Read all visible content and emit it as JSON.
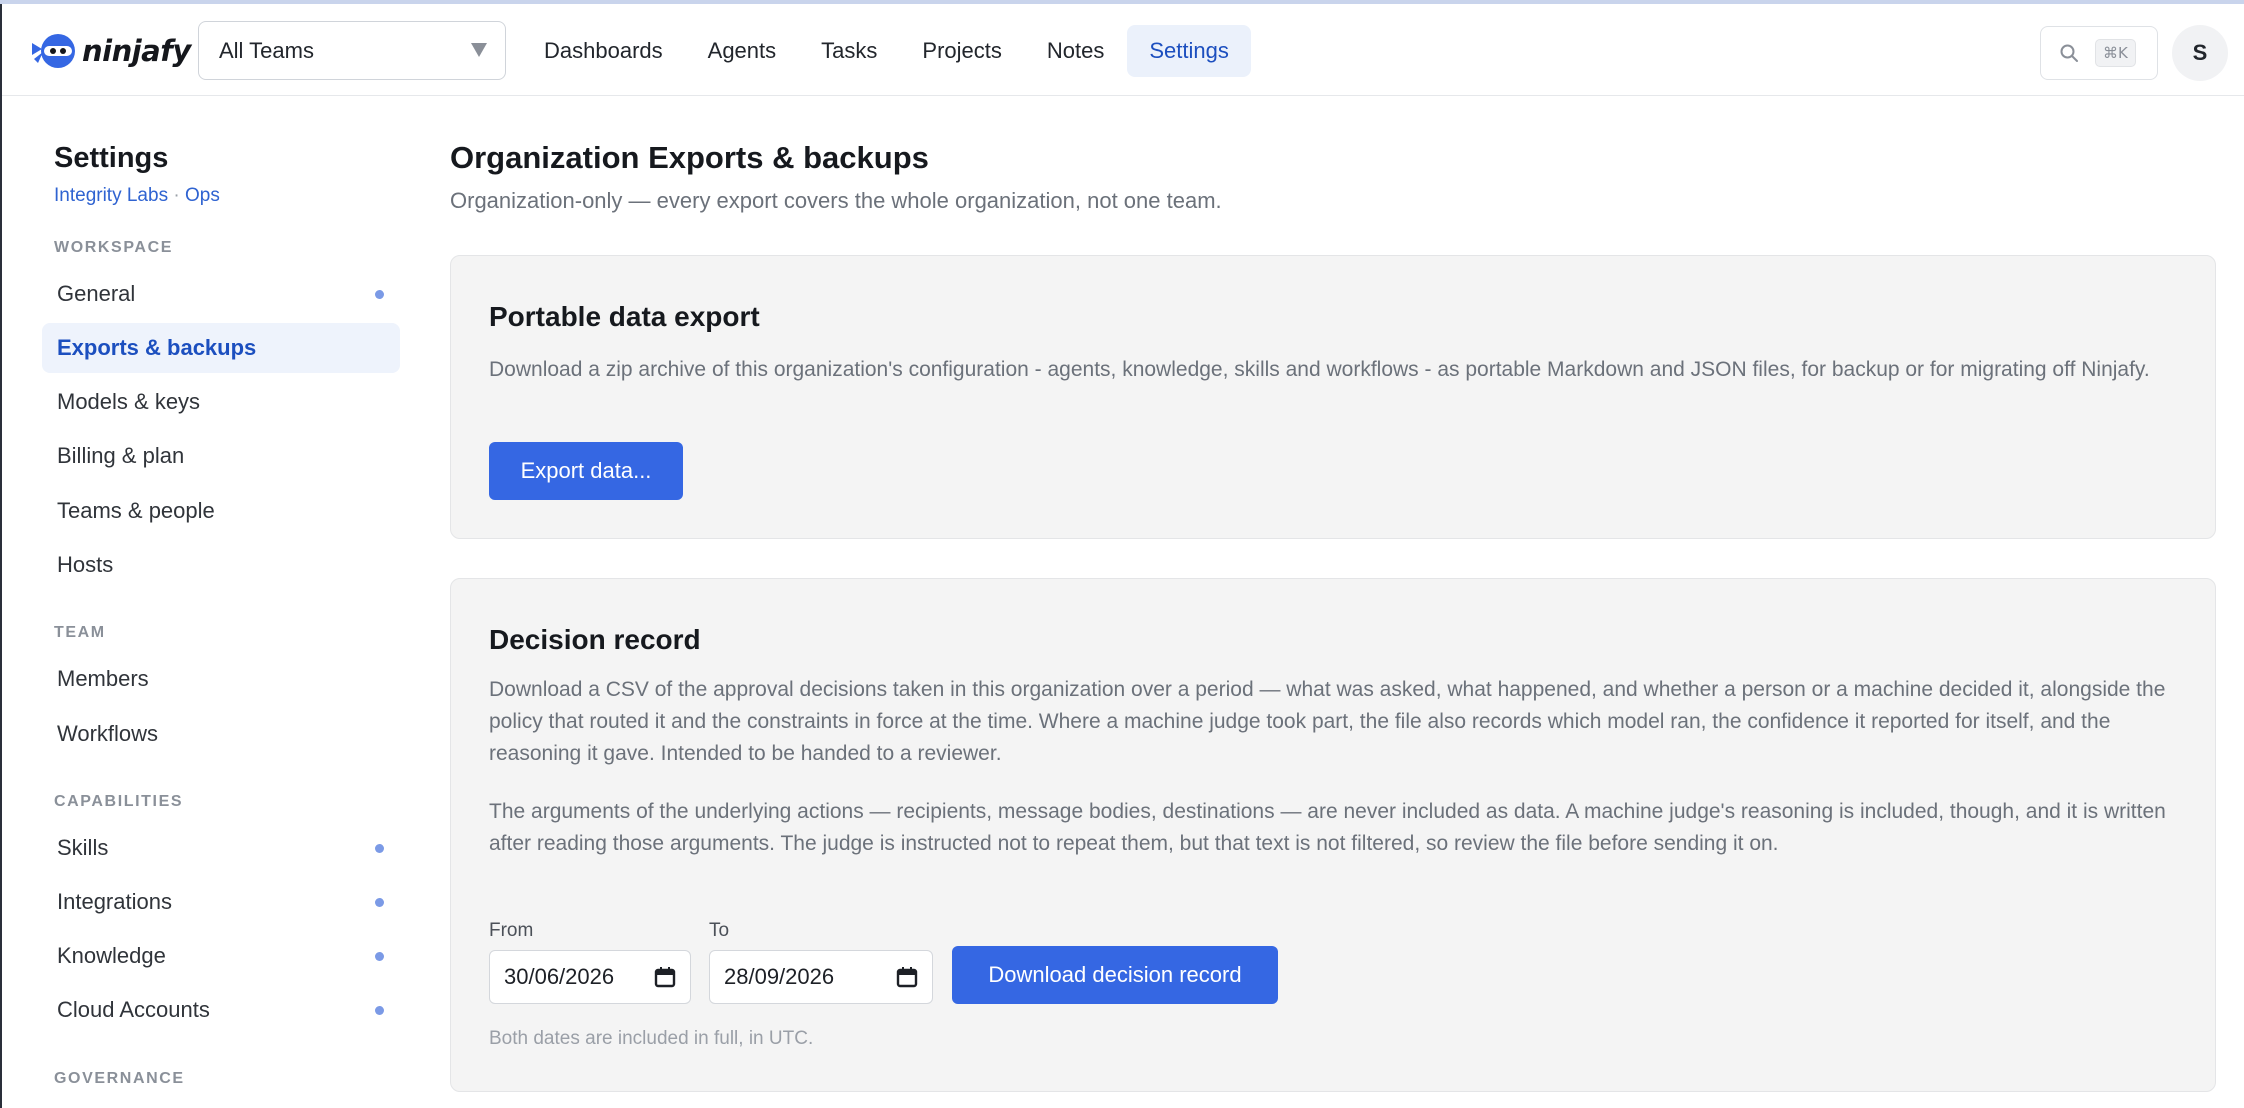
{
  "header": {
    "logo_text": "ninjafy",
    "team_select": "All Teams",
    "nav": [
      "Dashboards",
      "Agents",
      "Tasks",
      "Projects",
      "Notes",
      "Settings"
    ],
    "active_nav": "Settings",
    "search_shortcut": "⌘K",
    "avatar_initial": "S"
  },
  "sidebar": {
    "title": "Settings",
    "org": "Integrity Labs",
    "separator": "·",
    "team": "Ops",
    "sections": {
      "workspace": "WORKSPACE",
      "team": "TEAM",
      "capabilities": "CAPABILITIES",
      "governance": "GOVERNANCE"
    },
    "workspace_items": [
      "General",
      "Exports & backups",
      "Models & keys",
      "Billing & plan",
      "Teams & people",
      "Hosts"
    ],
    "team_items": [
      "Members",
      "Workflows"
    ],
    "capability_items": [
      "Skills",
      "Integrations",
      "Knowledge",
      "Cloud Accounts"
    ]
  },
  "main": {
    "title": "Organization Exports & backups",
    "subtitle": "Organization-only — every export covers the whole organization, not one team.",
    "export_card": {
      "title": "Portable data export",
      "description": "Download a zip archive of this organization's configuration - agents, knowledge, skills and workflows - as portable Markdown and JSON files, for backup or for migrating off Ninjafy.",
      "button": "Export data..."
    },
    "decision_card": {
      "title": "Decision record",
      "paragraph1": "Download a CSV of the approval decisions taken in this organization over a period — what was asked, what happened, and whether a person or a machine decided it, alongside the policy that routed it and the constraints in force at the time. Where a machine judge took part, the file also records which model ran, the confidence it reported for itself, and the reasoning it gave. Intended to be handed to a reviewer.",
      "paragraph2": "The arguments of the underlying actions — recipients, message bodies, destinations — are never included as data. A machine judge's reasoning is included, though, and it is written after reading those arguments. The judge is instructed not to repeat them, but that text is not filtered, so review the file before sending it on.",
      "from_label": "From",
      "from_value": "30/06/2026",
      "to_label": "To",
      "to_value": "28/09/2026",
      "button": "Download decision record",
      "hint": "Both dates are included in full, in UTC."
    }
  },
  "colors": {
    "accent": "#3567e3",
    "active_text": "#1c4fbf",
    "active_bg": "#eef3fc",
    "dot": "#7b9ae6"
  }
}
